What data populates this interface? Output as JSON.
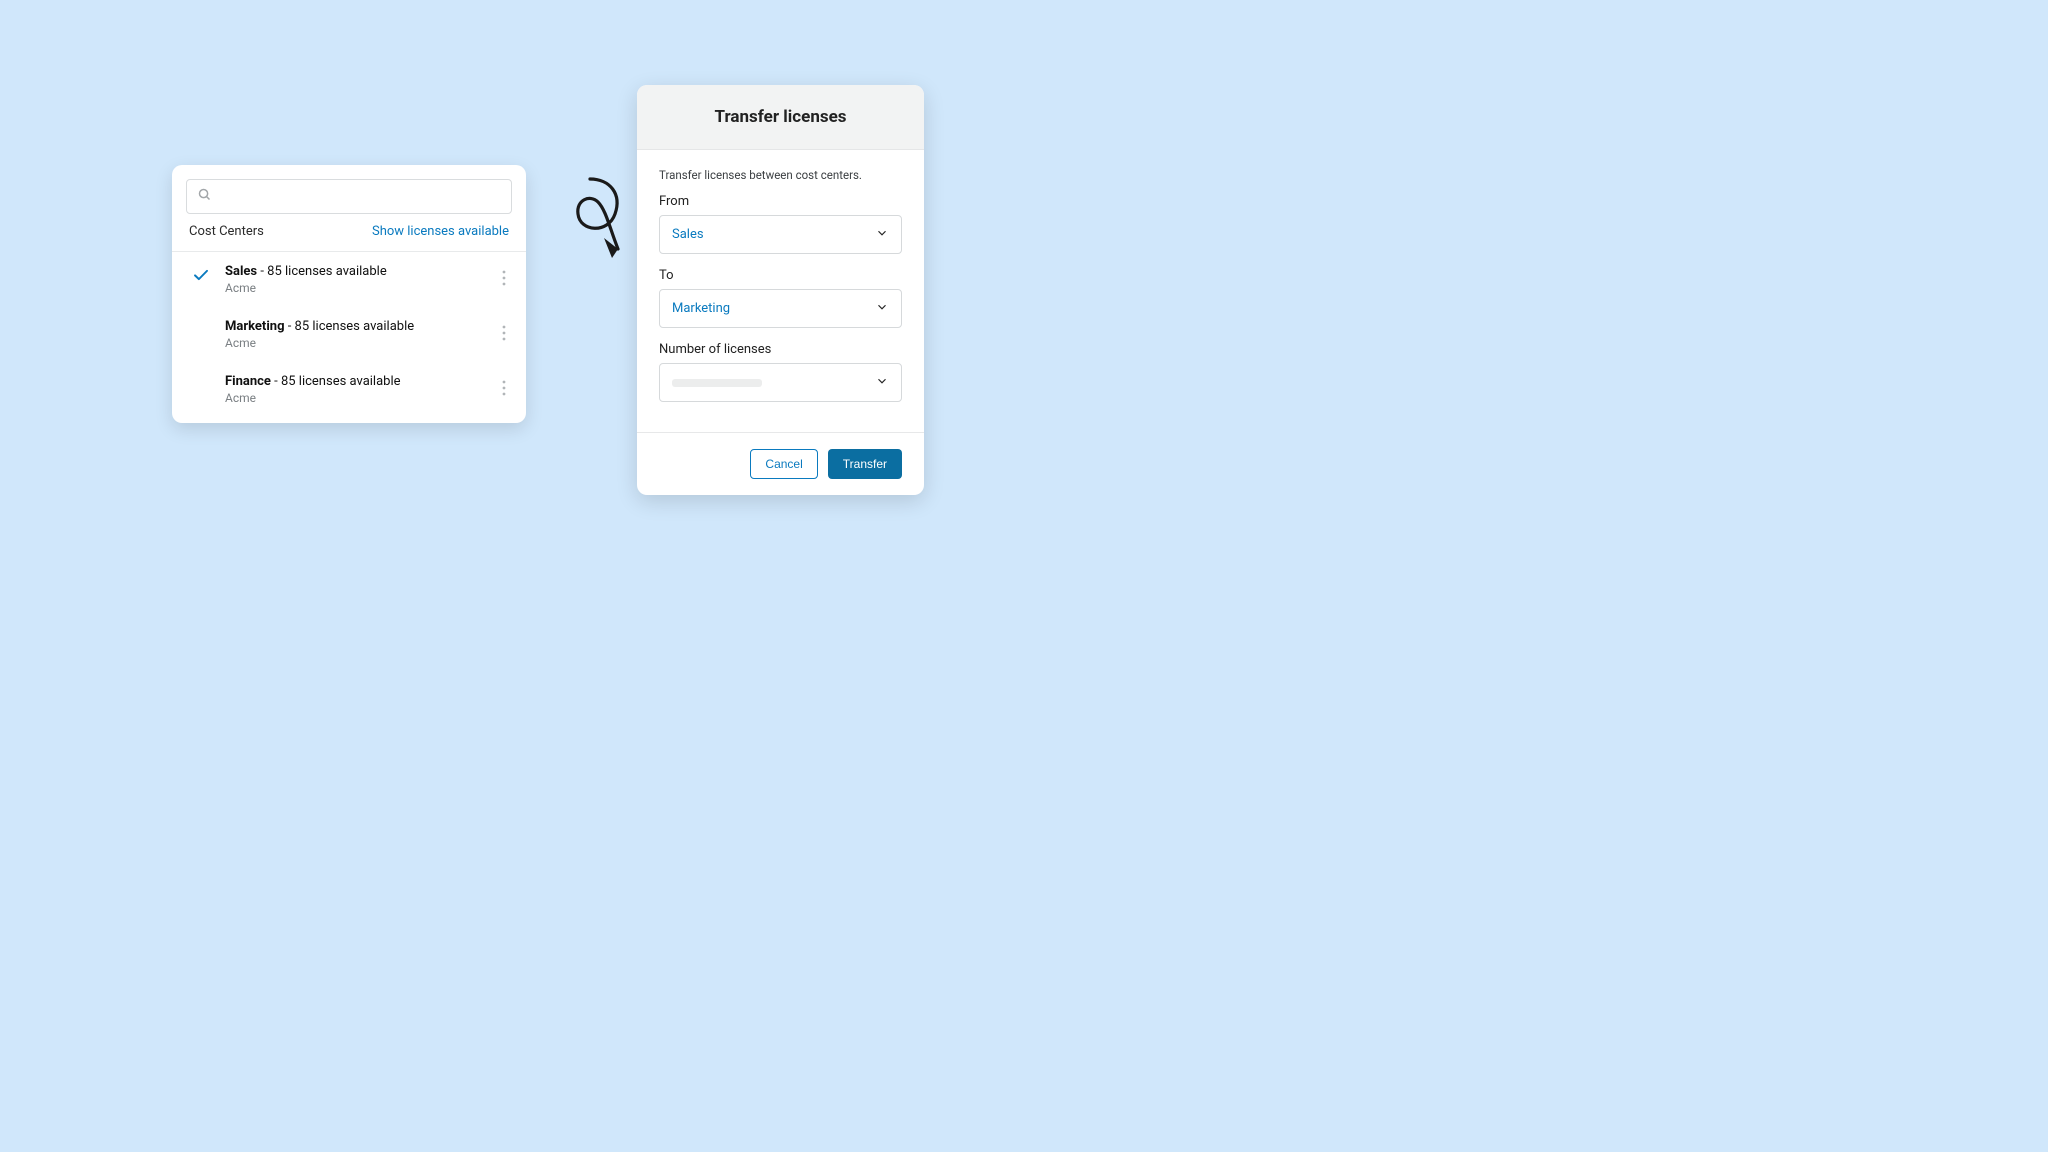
{
  "costCenters": {
    "title": "Cost Centers",
    "showLink": "Show licenses available",
    "items": [
      {
        "name": "Sales",
        "availability": "85 licenses available",
        "org": "Acme",
        "selected": true
      },
      {
        "name": "Marketing",
        "availability": "85 licenses available",
        "org": "Acme",
        "selected": false
      },
      {
        "name": "Finance",
        "availability": "85 licenses available",
        "org": "Acme",
        "selected": false
      }
    ]
  },
  "transfer": {
    "title": "Transfer licenses",
    "description": "Transfer licenses between cost centers.",
    "fromLabel": "From",
    "fromValue": "Sales",
    "toLabel": "To",
    "toValue": "Marketing",
    "numLabel": "Number of licenses",
    "cancel": "Cancel",
    "submit": "Transfer"
  }
}
